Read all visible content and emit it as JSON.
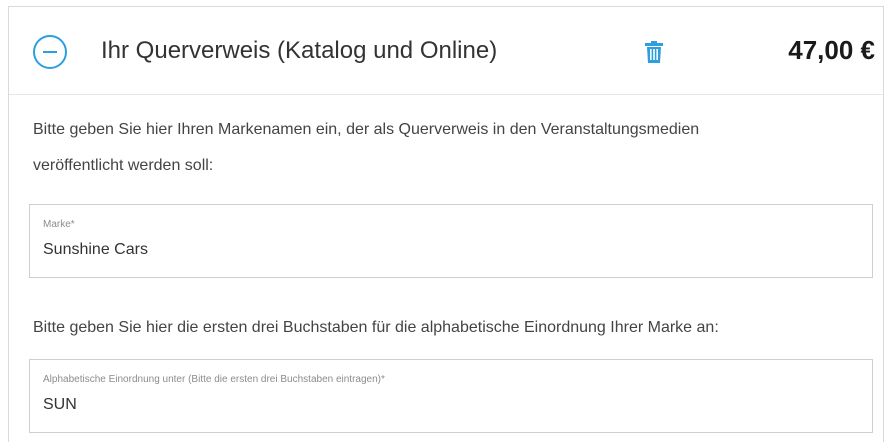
{
  "header": {
    "title": "Ihr Querverweis (Katalog und Online)",
    "price": "47,00 €",
    "collapse_icon": "minus-circle-icon",
    "delete_icon": "trash-icon"
  },
  "instructions": {
    "brand_line1": "Bitte geben Sie hier Ihren Markenamen ein, der als Querverweis in den Veranstaltungsmedien",
    "brand_line2": "veröffentlicht werden soll:",
    "alpha": "Bitte geben Sie hier die ersten drei Buchstaben für die alphabetische Einordnung Ihrer Marke an:"
  },
  "fields": {
    "brand": {
      "label": "Marke*",
      "value": "Sunshine Cars"
    },
    "alpha": {
      "label": "Alphabetische Einordnung unter (Bitte die ersten drei Buchstaben eintragen)*",
      "value": "SUN"
    }
  },
  "colors": {
    "accent": "#2d9fe0",
    "border": "#cfcfcf"
  }
}
